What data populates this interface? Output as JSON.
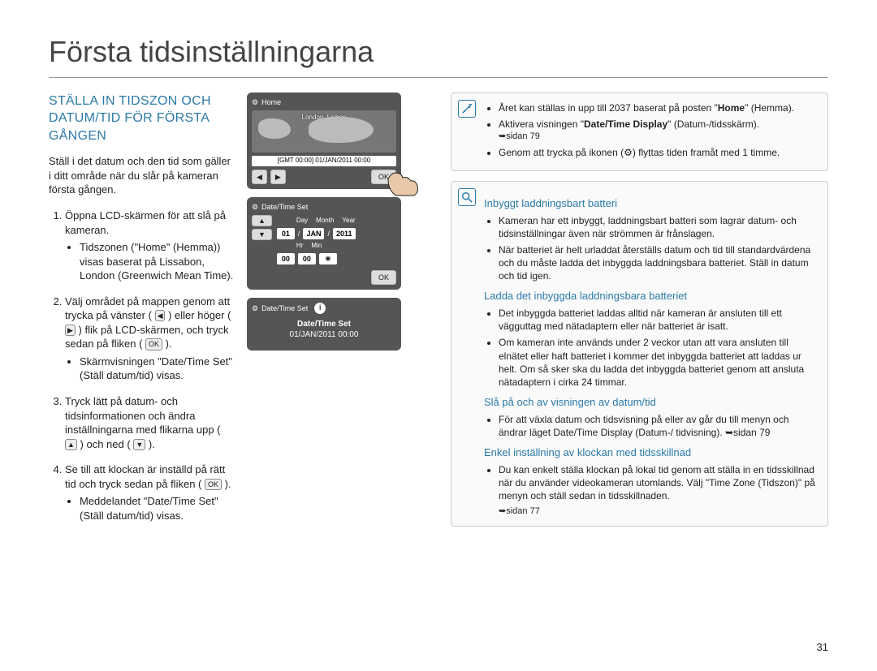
{
  "pageTitle": "Första tidsinställningarna",
  "pageNumber": "31",
  "sectionHeading": "STÄLLA IN TIDSZON OCH DATUM/TID FÖR FÖRSTA GÅNGEN",
  "intro": "Ställ i det datum och den tid som gäller i ditt område när du slår på kameran första gången.",
  "steps": {
    "s1": "Öppna LCD-skärmen för att slå på kameran.",
    "s1b": "Tidszonen (\"Home\" (Hemma)) visas baserat på Lissabon, London (Greenwich Mean Time).",
    "s2a": "Välj området på mappen genom att trycka på vänster (",
    "s2b": ") eller höger (",
    "s2c": ") flik på LCD-skärmen, och tryck sedan på fliken (",
    "s2d": ").",
    "s2e": "Skärmvisningen \"Date/Time Set\" (Ställ datum/tid) visas.",
    "s3a": "Tryck lätt på datum- och tidsinformationen och ändra inställningarna med flikarna upp (",
    "s3b": ") och ned (",
    "s3c": ").",
    "s4a": "Se till att klockan är inställd på rätt tid och tryck sedan på fliken (",
    "s4b": ").",
    "s4c": "Meddelandet \"Date/Time Set\" (Ställ datum/tid) visas."
  },
  "tags": {
    "ok": "OK",
    "left": "◀",
    "right": "▶",
    "up": "▲",
    "down": "▼"
  },
  "screens": {
    "home": {
      "title": "Home",
      "location": "London, Lisbon",
      "gmt": "[GMT 00:00] 01/JAN/2011 00:00",
      "ok": "OK"
    },
    "dateTimeSet": {
      "title": "Date/Time Set",
      "labels": {
        "day": "Day",
        "month": "Month",
        "year": "Year",
        "hr": "Hr",
        "min": "Min"
      },
      "values": {
        "day": "01",
        "month": "JAN",
        "year": "2011",
        "hr": "00",
        "min": "00"
      },
      "ok": "OK"
    },
    "confirm": {
      "title": "Date/Time Set",
      "line1": "Date/Time Set",
      "line2": "01/JAN/2011 00:00"
    }
  },
  "infoBox": {
    "b1a": "Året kan ställas in upp till 2037 baserat på posten \"",
    "b1b": "Home",
    "b1c": "\" (Hemma).",
    "b2a": "Aktivera visningen \"",
    "b2b": "Date/Time Display",
    "b2c": "\" (Datum-/tidsskärm).",
    "b2ref": "➥sidan 79",
    "b3": "Genom att trycka på ikonen (⚙) flyttas tiden framåt med 1 timme."
  },
  "note": {
    "h1": "Inbyggt laddningsbart batteri",
    "h1b1": "Kameran har ett inbyggt, laddningsbart batteri som lagrar datum- och tidsinställningar även när strömmen är frånslagen.",
    "h1b2": "När batteriet är helt urladdat återställs datum och tid till standardvärdena och du måste ladda det inbyggda laddningsbara batteriet. Ställ in datum och tid igen.",
    "h2": "Ladda det inbyggda laddningsbara batteriet",
    "h2b1": "Det inbyggda batteriet laddas alltid när kameran är ansluten till ett vägguttag med nätadaptern eller när batteriet är isatt.",
    "h2b2": "Om kameran inte används under 2 veckor utan att vara ansluten till elnätet eller haft batteriet i kommer det inbyggda batteriet att laddas ur helt. Om så sker ska du ladda det inbyggda batteriet genom att ansluta nätadaptern i cirka 24 timmar.",
    "h3": "Slå på och av visningen av datum/tid",
    "h3b1": "För att växla datum och tidsvisning på eller av går du till menyn och ändrar läget Date/Time Display (Datum-/ tidvisning). ➥sidan 79",
    "h4": "Enkel inställning av klockan med tidsskillnad",
    "h4b1": "Du kan enkelt ställa klockan på lokal tid genom att ställa in en tidsskillnad när du använder videokameran utomlands. Välj \"Time Zone (Tidszon)\" på menyn och ställ sedan in tidsskillnaden.",
    "h4ref": "➥sidan 77"
  }
}
